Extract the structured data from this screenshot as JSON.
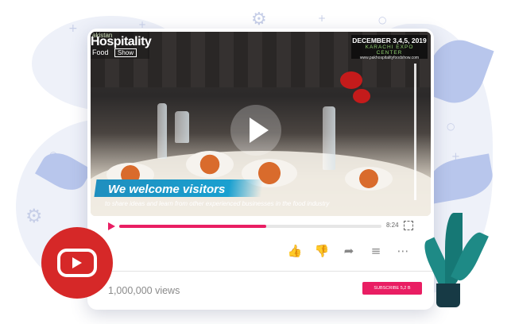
{
  "video": {
    "logo_top": "akistan",
    "logo_main": "Hospitality",
    "logo_sub_left": "Food",
    "logo_sub_right": "Show",
    "event_dates": "DECEMBER 3,4,5, 2019",
    "event_venue": "KARACHI EXPO CENTER",
    "event_url": "www.pakhospitalityfoodshow.com",
    "headline": "We welcome visitors",
    "subline": "to share ideas  and learn from other experienced businesses in the food industry"
  },
  "player": {
    "duration": "8:24",
    "progress_fraction": 0.56
  },
  "actions": {
    "like_icon": "thumbs-up-icon",
    "dislike_icon": "thumbs-down-icon",
    "share_icon": "share-icon",
    "add_icon": "add-to-playlist-icon",
    "more_icon": "more-icon"
  },
  "footer": {
    "views": "1,000,000 views",
    "subscribe_label": "SUBSCRIBE 5,2 B"
  },
  "colors": {
    "accent": "#e91e63",
    "youtube_red": "#d62828"
  }
}
